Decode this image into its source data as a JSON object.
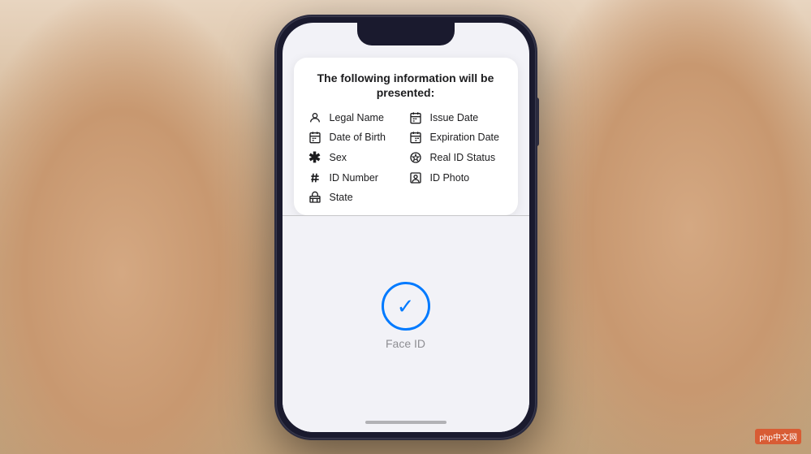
{
  "scene": {
    "watermark": "php中文网"
  },
  "phone": {
    "card": {
      "title": "The following information will be presented:",
      "items_left": [
        {
          "id": "legal-name",
          "icon": "person",
          "label": "Legal Name"
        },
        {
          "id": "date-of-birth",
          "icon": "calendar",
          "label": "Date of Birth"
        },
        {
          "id": "sex",
          "icon": "asterisk",
          "label": "Sex"
        },
        {
          "id": "id-number",
          "icon": "hash",
          "label": "ID Number"
        },
        {
          "id": "state",
          "icon": "building",
          "label": "State"
        }
      ],
      "items_right": [
        {
          "id": "issue-date",
          "icon": "calendar2",
          "label": "Issue Date"
        },
        {
          "id": "expiration-date",
          "icon": "calendar2",
          "label": "Expiration Date"
        },
        {
          "id": "real-id-status",
          "icon": "star-circle",
          "label": "Real ID Status"
        },
        {
          "id": "id-photo",
          "icon": "person-square",
          "label": "ID Photo"
        }
      ]
    },
    "face_id": {
      "label": "Face ID"
    }
  }
}
